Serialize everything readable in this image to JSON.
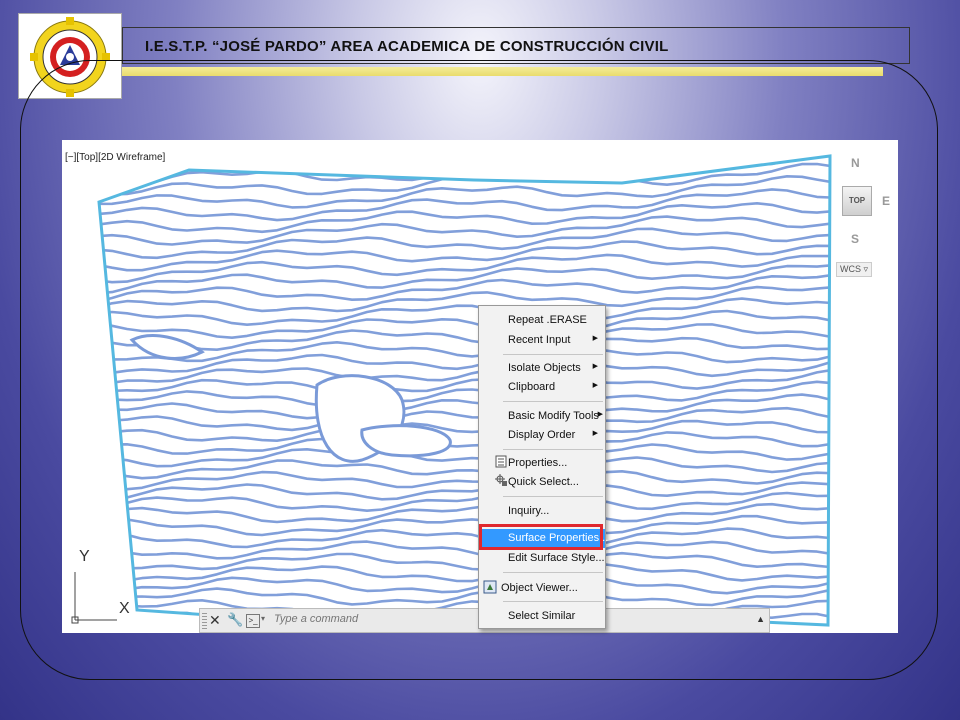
{
  "header": {
    "title": "I.E.S.T.P. “JOSÉ PARDO” AREA ACADEMICA DE CONSTRUCCIÓN CIVIL"
  },
  "cad": {
    "viewport_label": "[−][Top][2D Wireframe]",
    "viewcube": {
      "north": "N",
      "east": "E",
      "south": "S",
      "face": "TOP",
      "wcs": "WCS"
    },
    "ucs": {
      "y": "Y",
      "x": "X"
    },
    "command_line": {
      "placeholder": "Type a command"
    }
  },
  "context_menu": {
    "items": [
      {
        "label": "Repeat .ERASE",
        "submenu": false
      },
      {
        "label": "Recent Input",
        "submenu": true
      },
      {
        "label": "Isolate Objects",
        "submenu": true
      },
      {
        "label": "Clipboard",
        "submenu": true
      },
      {
        "label": "Basic Modify Tools",
        "submenu": true
      },
      {
        "label": "Display Order",
        "submenu": true
      },
      {
        "label": "Properties...",
        "icon": "properties-icon"
      },
      {
        "label": "Quick Select...",
        "icon": "quick-select-icon"
      },
      {
        "label": "Inquiry..."
      },
      {
        "label": "Surface Properties...",
        "highlighted": true
      },
      {
        "label": "Edit Surface Style..."
      },
      {
        "label": "Object Viewer...",
        "icon": "object-viewer-icon"
      },
      {
        "label": "Select Similar"
      }
    ]
  },
  "colors": {
    "contour": "#7a9ad8",
    "boundary": "#55b8e0",
    "menu_highlight": "#3399ff",
    "callout": "#e0282e",
    "accent_bar": "#e9dc6d"
  }
}
